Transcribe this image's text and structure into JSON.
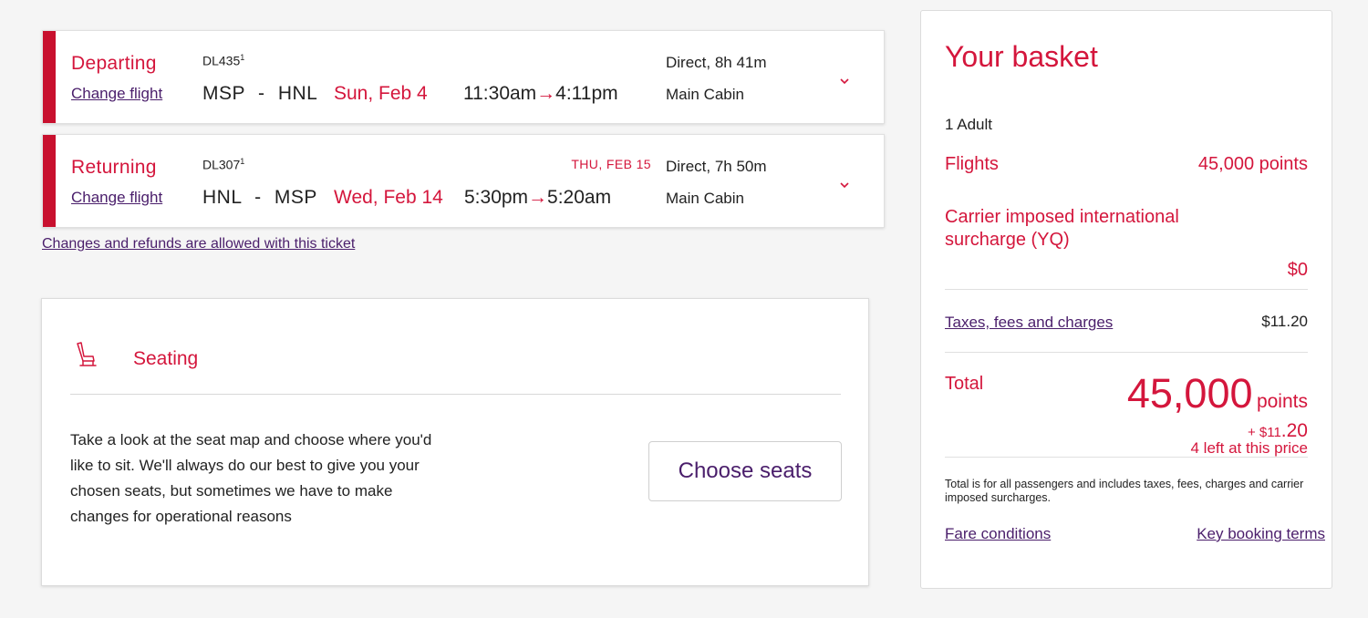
{
  "flights": {
    "departing": {
      "label": "Departing",
      "change_link": "Change flight",
      "flight_number": "DL435",
      "footnote": "1",
      "route_from": "MSP",
      "route_sep": "-",
      "route_to": "HNL",
      "date": "Sun, Feb 4",
      "depart_time": "11:30am",
      "arrow": "→",
      "arrive_time": "4:11pm",
      "duration": "Direct, 8h 41m",
      "cabin": "Main Cabin",
      "chevron": "chevron-down-icon"
    },
    "returning": {
      "label": "Returning",
      "change_link": "Change flight",
      "flight_number": "DL307",
      "footnote": "1",
      "route_from": "HNL",
      "route_sep": "-",
      "route_to": "MSP",
      "date": "Wed, Feb 14",
      "depart_time": "5:30pm",
      "arrow": "→",
      "arrive_time": "5:20am",
      "arrive_date": "THU, FEB 15",
      "duration": "Direct, 7h 50m",
      "cabin": "Main Cabin",
      "chevron": "chevron-down-icon"
    },
    "refund_link": "Changes and refunds are allowed with this ticket"
  },
  "seating": {
    "icon": "seat-icon",
    "title": "Seating",
    "description": "Take a look at the seat map and choose where you'd like to sit. We'll always do our best to give you your chosen seats, but sometimes we have to make changes for operational reasons",
    "button": "Choose seats"
  },
  "basket": {
    "title": "Your basket",
    "passengers": "1 Adult",
    "flights_label": "Flights",
    "flights_value": "45,000 points",
    "surcharge_label": "Carrier imposed international surcharge (YQ)",
    "surcharge_value": "$0",
    "taxes_label": "Taxes, fees and charges",
    "taxes_value": "$11.20",
    "total_label": "Total",
    "total_points": "45,000",
    "total_points_unit": "points",
    "plus_cash_prefix": "+ $11",
    "plus_cash_cents": ".20",
    "left_at_price": "4 left at this price",
    "total_note": "Total is for all passengers and includes taxes, fees, charges and carrier imposed surcharges.",
    "fare_conditions": "Fare conditions",
    "key_terms": "Key booking terms"
  },
  "colors": {
    "accent_red": "#d4163c",
    "stripe_red": "#c8102e",
    "link_purple": "#4a1e6b",
    "background": "#f5f5f5"
  }
}
